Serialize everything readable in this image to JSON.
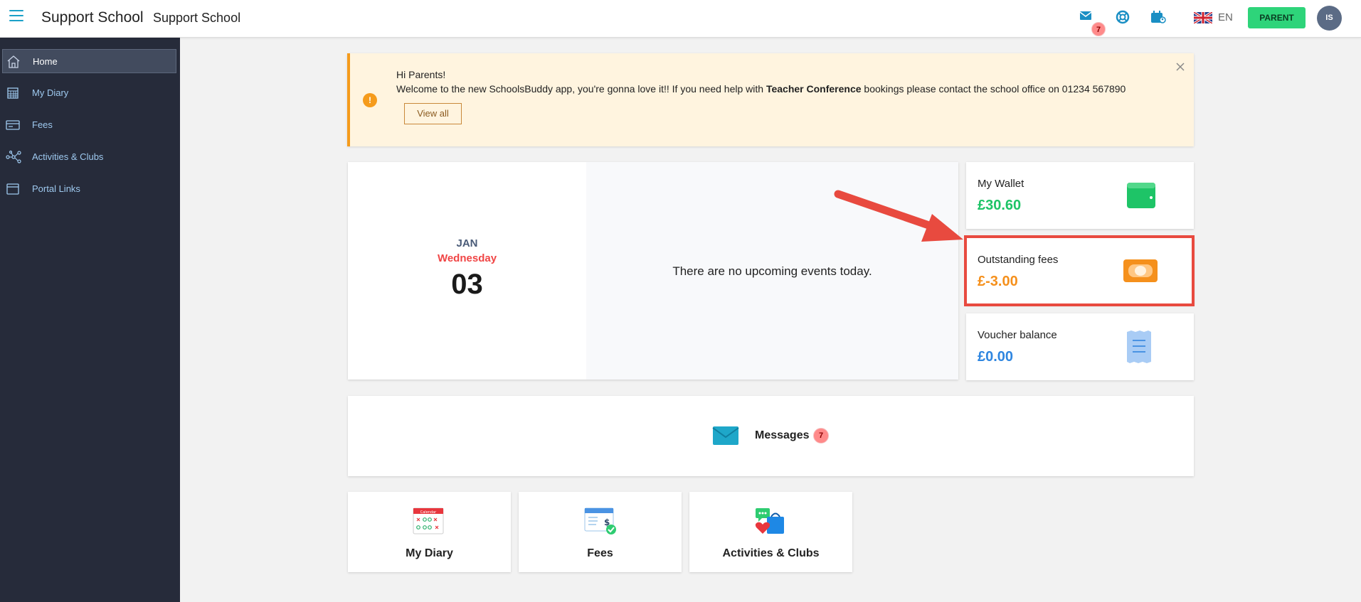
{
  "header": {
    "school_name_primary": "Support School",
    "school_name_secondary": "Support School",
    "mail_badge_count": "7",
    "language": "EN",
    "role_button": "PARENT",
    "avatar_initials": "IS"
  },
  "sidebar": {
    "items": [
      {
        "label": "Home",
        "icon": "home-icon",
        "active": true
      },
      {
        "label": "My Diary",
        "icon": "calendar-grid-icon"
      },
      {
        "label": "Fees",
        "icon": "credit-card-icon"
      },
      {
        "label": "Activities & Clubs",
        "icon": "network-icon"
      },
      {
        "label": "Portal Links",
        "icon": "browser-window-icon"
      }
    ]
  },
  "alert": {
    "greeting": "Hi Parents!",
    "message_start": "Welcome to the new SchoolsBuddy app, you're gonna love it!!  If you need help with ",
    "message_bold": "Teacher Conference",
    "message_end": " bookings please contact the school office on 01234 567890",
    "button": "View all"
  },
  "date_card": {
    "month": "JAN",
    "weekday": "Wednesday",
    "day": "03",
    "empty_message": "There are no upcoming events today."
  },
  "stats": {
    "wallet": {
      "label": "My Wallet",
      "value": "£30.60",
      "color": "#1ec467"
    },
    "fees": {
      "label": "Outstanding fees",
      "value": "£-3.00",
      "color": "#f5901c"
    },
    "voucher": {
      "label": "Voucher balance",
      "value": "£0.00",
      "color": "#2f86e0"
    }
  },
  "messages": {
    "label": "Messages",
    "count": "7"
  },
  "tiles": [
    {
      "label": "My Diary",
      "icon": "calendar-icon"
    },
    {
      "label": "Fees",
      "icon": "invoice-icon"
    },
    {
      "label": "Activities & Clubs",
      "icon": "chat-shopping-icon"
    }
  ],
  "colors": {
    "accent": "#1aa0c8",
    "sidebar_bg": "#262b3a",
    "alert_bg": "#fff4df",
    "alert_border": "#f59b1c",
    "highlight": "#e84a3f",
    "parent_button": "#2ed47a"
  }
}
